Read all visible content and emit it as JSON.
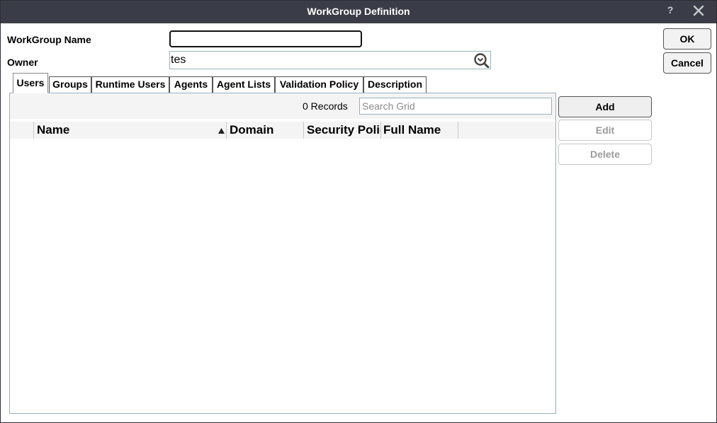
{
  "window": {
    "title": "WorkGroup Definition",
    "help_label": "?",
    "title_bar_color": "#3a3d48"
  },
  "form": {
    "name_label": "WorkGroup Name",
    "name_value": "",
    "owner_label": "Owner",
    "owner_value": "tes",
    "owner_lookup_icon": "search-lookup-icon"
  },
  "actions": {
    "ok_label": "OK",
    "cancel_label": "Cancel"
  },
  "tabs": [
    {
      "label": "Users",
      "active": true
    },
    {
      "label": "Groups",
      "active": false
    },
    {
      "label": "Runtime Users",
      "active": false
    },
    {
      "label": "Agents",
      "active": false
    },
    {
      "label": "Agent Lists",
      "active": false
    },
    {
      "label": "Validation Policy",
      "active": false
    },
    {
      "label": "Description",
      "active": false
    }
  ],
  "grid": {
    "records_text": "0 Records",
    "search_placeholder": "Search Grid",
    "columns": [
      "Name",
      "Domain",
      "Security Policy",
      "Full Name"
    ],
    "sort_column": "Name",
    "sort_direction": "ascending",
    "rows": []
  },
  "grid_actions": {
    "add_label": "Add",
    "edit_label": "Edit",
    "delete_label": "Delete",
    "edit_enabled": false,
    "delete_enabled": false
  }
}
